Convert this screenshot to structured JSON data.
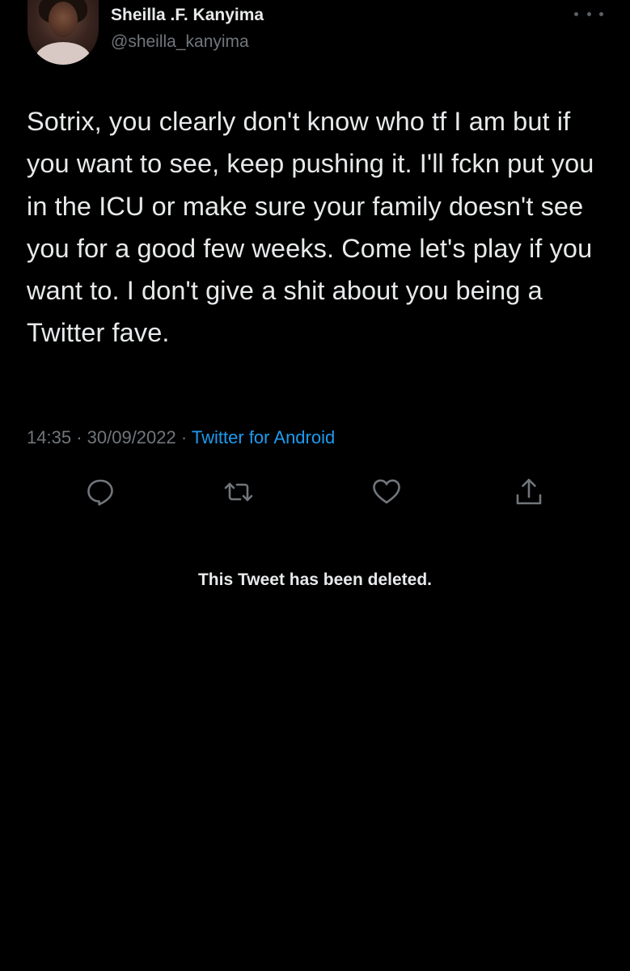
{
  "tweet": {
    "author": {
      "display_name": "Sheilla .F. Kanyima",
      "handle": "@sheilla_kanyima"
    },
    "text": "Sotrix, you clearly don't know who tf I am but if you want to see, keep pushing it. I'll fckn put you in the ICU or make sure your family doesn't see you for a good few weeks. Come let's play if you want to. I don't give a shit about you being a Twitter fave.",
    "time": "14:35",
    "separator": "·",
    "date": "30/09/2022",
    "source": "Twitter for Android",
    "actions": {
      "reply_icon": "reply-icon",
      "retweet_icon": "retweet-icon",
      "like_icon": "heart-icon",
      "share_icon": "share-icon"
    }
  },
  "deleted_notice": "This Tweet has been deleted.",
  "colors": {
    "background": "#000000",
    "text_primary": "#e7e9ea",
    "text_secondary": "#71767b",
    "link": "#1d9bf0"
  }
}
